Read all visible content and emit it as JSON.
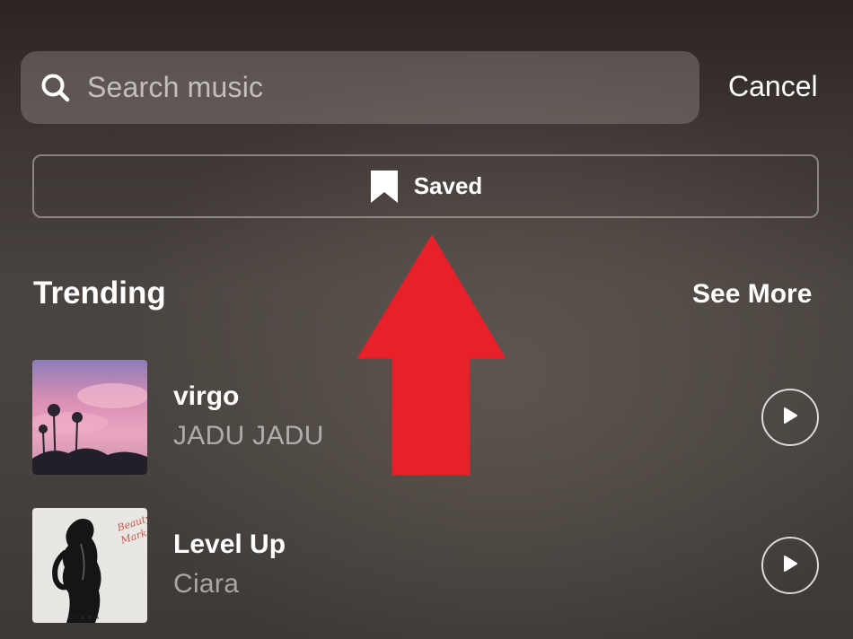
{
  "search": {
    "placeholder": "Search music",
    "cancel_label": "Cancel"
  },
  "saved_button": {
    "label": "Saved",
    "icon": "bookmark-icon"
  },
  "trending": {
    "title": "Trending",
    "see_more_label": "See More",
    "tracks": [
      {
        "title": "virgo",
        "artist": "JADU JADU",
        "cover": "pink-sky-palm-trees-cover"
      },
      {
        "title": "Level Up",
        "artist": "Ciara",
        "cover": "black-white-figure-cover"
      }
    ]
  },
  "annotation": {
    "type": "red-arrow-up",
    "color": "#e8202a"
  },
  "colors": {
    "text_primary": "#ffffff",
    "text_secondary": "#b9b4b0",
    "annotation": "#e8202a"
  }
}
